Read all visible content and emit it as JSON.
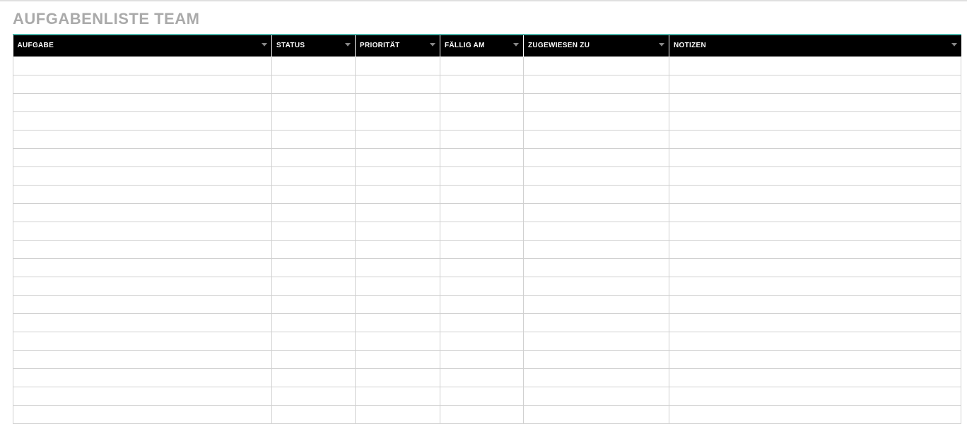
{
  "page": {
    "title": "AUFGABENLISTE TEAM"
  },
  "table": {
    "columns": [
      {
        "key": "aufgabe",
        "label": "AUFGABE"
      },
      {
        "key": "status",
        "label": "STATUS"
      },
      {
        "key": "prioritaet",
        "label": "PRIORITÄT"
      },
      {
        "key": "faellig",
        "label": "FÄLLIG AM"
      },
      {
        "key": "zugewiesen",
        "label": "ZUGEWIESEN ZU"
      },
      {
        "key": "notizen",
        "label": "NOTIZEN"
      }
    ],
    "rows": [
      {
        "aufgabe": "",
        "status": "",
        "prioritaet": "",
        "faellig": "",
        "zugewiesen": "",
        "notizen": ""
      },
      {
        "aufgabe": "",
        "status": "",
        "prioritaet": "",
        "faellig": "",
        "zugewiesen": "",
        "notizen": ""
      },
      {
        "aufgabe": "",
        "status": "",
        "prioritaet": "",
        "faellig": "",
        "zugewiesen": "",
        "notizen": ""
      },
      {
        "aufgabe": "",
        "status": "",
        "prioritaet": "",
        "faellig": "",
        "zugewiesen": "",
        "notizen": ""
      },
      {
        "aufgabe": "",
        "status": "",
        "prioritaet": "",
        "faellig": "",
        "zugewiesen": "",
        "notizen": ""
      },
      {
        "aufgabe": "",
        "status": "",
        "prioritaet": "",
        "faellig": "",
        "zugewiesen": "",
        "notizen": ""
      },
      {
        "aufgabe": "",
        "status": "",
        "prioritaet": "",
        "faellig": "",
        "zugewiesen": "",
        "notizen": ""
      },
      {
        "aufgabe": "",
        "status": "",
        "prioritaet": "",
        "faellig": "",
        "zugewiesen": "",
        "notizen": ""
      },
      {
        "aufgabe": "",
        "status": "",
        "prioritaet": "",
        "faellig": "",
        "zugewiesen": "",
        "notizen": ""
      },
      {
        "aufgabe": "",
        "status": "",
        "prioritaet": "",
        "faellig": "",
        "zugewiesen": "",
        "notizen": ""
      },
      {
        "aufgabe": "",
        "status": "",
        "prioritaet": "",
        "faellig": "",
        "zugewiesen": "",
        "notizen": ""
      },
      {
        "aufgabe": "",
        "status": "",
        "prioritaet": "",
        "faellig": "",
        "zugewiesen": "",
        "notizen": ""
      },
      {
        "aufgabe": "",
        "status": "",
        "prioritaet": "",
        "faellig": "",
        "zugewiesen": "",
        "notizen": ""
      },
      {
        "aufgabe": "",
        "status": "",
        "prioritaet": "",
        "faellig": "",
        "zugewiesen": "",
        "notizen": ""
      },
      {
        "aufgabe": "",
        "status": "",
        "prioritaet": "",
        "faellig": "",
        "zugewiesen": "",
        "notizen": ""
      },
      {
        "aufgabe": "",
        "status": "",
        "prioritaet": "",
        "faellig": "",
        "zugewiesen": "",
        "notizen": ""
      },
      {
        "aufgabe": "",
        "status": "",
        "prioritaet": "",
        "faellig": "",
        "zugewiesen": "",
        "notizen": ""
      },
      {
        "aufgabe": "",
        "status": "",
        "prioritaet": "",
        "faellig": "",
        "zugewiesen": "",
        "notizen": ""
      },
      {
        "aufgabe": "",
        "status": "",
        "prioritaet": "",
        "faellig": "",
        "zugewiesen": "",
        "notizen": ""
      },
      {
        "aufgabe": "",
        "status": "",
        "prioritaet": "",
        "faellig": "",
        "zugewiesen": "",
        "notizen": ""
      }
    ]
  }
}
